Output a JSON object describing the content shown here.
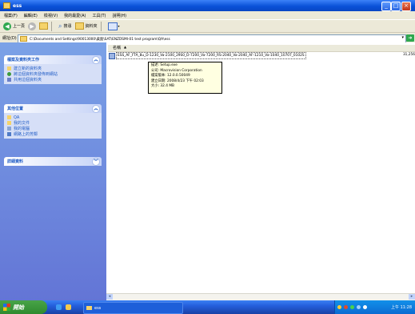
{
  "window": {
    "title": "ess"
  },
  "menu": [
    "檔案(F)",
    "編輯(E)",
    "檢視(V)",
    "我的最愛(A)",
    "工具(T)",
    "說明(H)"
  ],
  "toolbar": {
    "back_label": "上一頁",
    "search_label": "搜尋",
    "folders_label": "資料夾"
  },
  "address": {
    "label": "網址(D)",
    "path": "C:\\Documents and Settings\\90013000\\桌面\\SAT\\ENZDSMI-01 test program\\QA\\ess",
    "go_label": "移至"
  },
  "panes": [
    {
      "title": "檔案及資料夾工作",
      "items": [
        "建立新的資料夾",
        "將這個資料夾發佈到網站",
        "共用這個資料夾"
      ]
    },
    {
      "title": "其他位置",
      "items": [
        "QA",
        "我的文件",
        "我的電腦",
        "網路上的芳鄰"
      ]
    },
    {
      "title": "詳細資料",
      "items": []
    }
  ],
  "list": {
    "column_name": "名稱",
    "file_name": "ESS_AF_FTA_8u_D-1230_Va-2100_29S0_D-7200_Va-7200_RS-2040_Va-2040_AF-1210_Va-1040_10707_0102S",
    "file_size": "31,256"
  },
  "tooltip": [
    "描述: Setup.exe",
    "公司: Macrovision Corporation",
    "檔案版本: 12.0.0.50049",
    "建立日期: 2008/4/23 下午 02:03",
    "大小: 32.4 MB"
  ],
  "taskbar": {
    "start_label": "開始",
    "task_label": "ess",
    "clock": "上午 11:28"
  },
  "colors": {
    "titlebar": "#0a52d8",
    "taskpane": "#6f8fe0",
    "start": "#3a983a",
    "tooltip_bg": "#ffffe1"
  }
}
